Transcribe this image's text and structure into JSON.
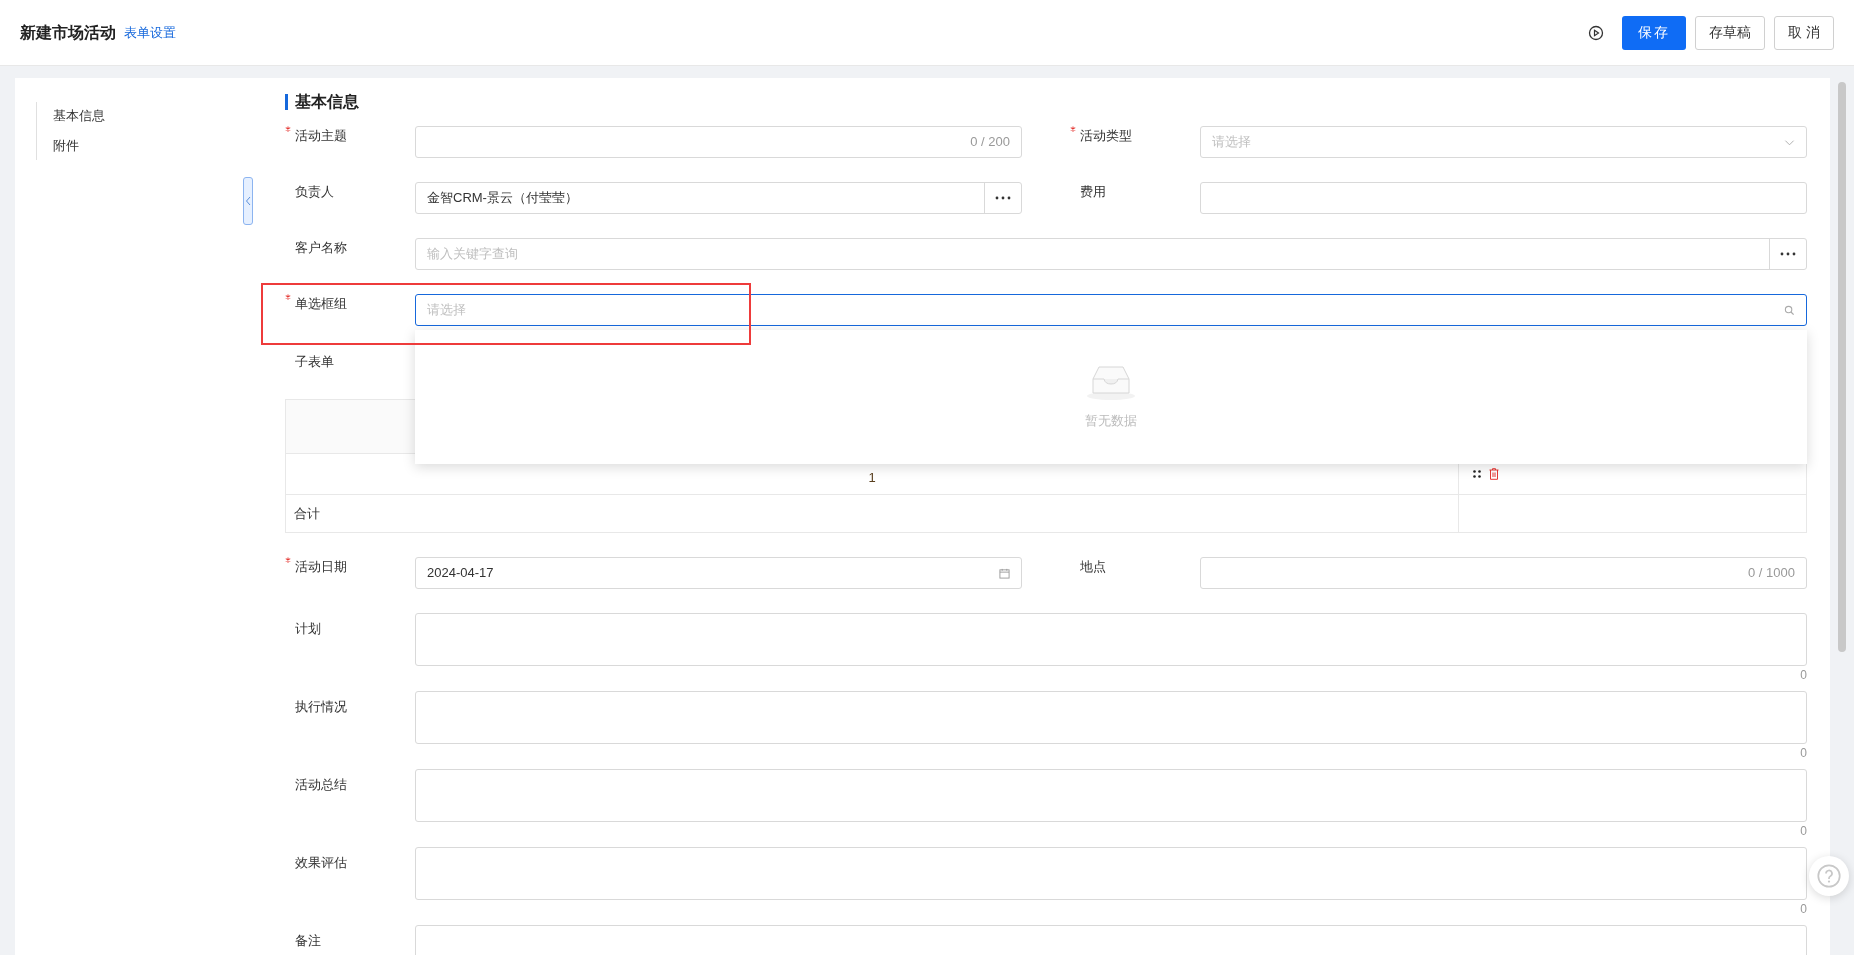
{
  "header": {
    "title": "新建市场活动",
    "settings_link": "表单设置",
    "buttons": [
      {
        "label": "保存",
        "kind": "primary"
      },
      {
        "label": "存草稿",
        "kind": "default"
      },
      {
        "label": "取 消",
        "kind": "default"
      }
    ]
  },
  "nav": {
    "items": [
      {
        "label": "基本信息"
      },
      {
        "label": "附件"
      }
    ]
  },
  "section": {
    "title": "基本信息"
  },
  "rows": [
    {
      "fields": [
        {
          "kind": "text",
          "label": "活动主题",
          "required": true,
          "counter": "0 / 200"
        },
        {
          "kind": "select",
          "label": "活动类型",
          "required": true,
          "placeholder": "请选择"
        }
      ]
    },
    {
      "fields": [
        {
          "kind": "picker",
          "label": "负责人",
          "required": false,
          "value": "金智CRM-景云（付莹莹）"
        },
        {
          "kind": "text",
          "label": "费用",
          "required": false
        }
      ]
    },
    {
      "fields": [
        {
          "kind": "picker",
          "label": "客户名称",
          "required": false,
          "placeholder": "输入关键字查询"
        }
      ]
    },
    {
      "fields": [
        {
          "kind": "search",
          "label": "单选框组",
          "required": true,
          "placeholder": "请选择",
          "focused": true,
          "highlighted": true,
          "dropdown": {
            "empty_text": "暂无数据"
          }
        }
      ]
    },
    {
      "fields": [
        {
          "kind": "subform",
          "label": "子表单",
          "rows": [
            {
              "index": "1"
            }
          ],
          "total_label": "合计"
        }
      ]
    },
    {
      "fields": [
        {
          "kind": "date",
          "label": "活动日期",
          "required": true,
          "value": "2024-04-17"
        },
        {
          "kind": "text",
          "label": "地点",
          "required": false,
          "counter": "0 / 1000"
        }
      ]
    },
    {
      "fields": [
        {
          "kind": "textarea",
          "label": "计划",
          "required": false,
          "counter": "0"
        }
      ]
    },
    {
      "fields": [
        {
          "kind": "textarea",
          "label": "执行情况",
          "required": false,
          "counter": "0"
        }
      ]
    },
    {
      "fields": [
        {
          "kind": "textarea",
          "label": "活动总结",
          "required": false,
          "counter": "0"
        }
      ]
    },
    {
      "fields": [
        {
          "kind": "textarea",
          "label": "效果评估",
          "required": false,
          "counter": "0"
        }
      ]
    },
    {
      "fields": [
        {
          "kind": "textarea",
          "label": "备注",
          "required": false
        }
      ]
    }
  ]
}
